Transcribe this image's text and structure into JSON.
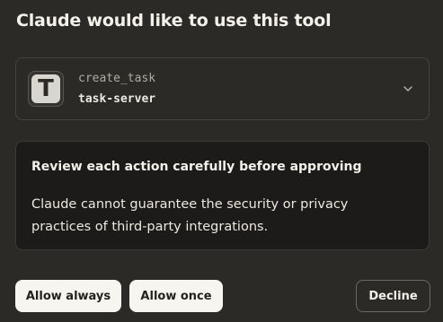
{
  "dialog": {
    "title": "Claude would like to use this tool"
  },
  "tool": {
    "avatar_letter": "T",
    "name": "create_task",
    "server": "task-server",
    "expand_icon": "chevron-down-icon"
  },
  "warning": {
    "title": "Review each action carefully before approving",
    "body": "Claude cannot guarantee the security or privacy practices of third-party integrations."
  },
  "actions": {
    "allow_always": "Allow always",
    "allow_once": "Allow once",
    "decline": "Decline"
  },
  "colors": {
    "background": "#2b2a27",
    "warning_background": "#1c1b19",
    "light_button": "#f7f5f0",
    "text": "#f4f1ea"
  }
}
